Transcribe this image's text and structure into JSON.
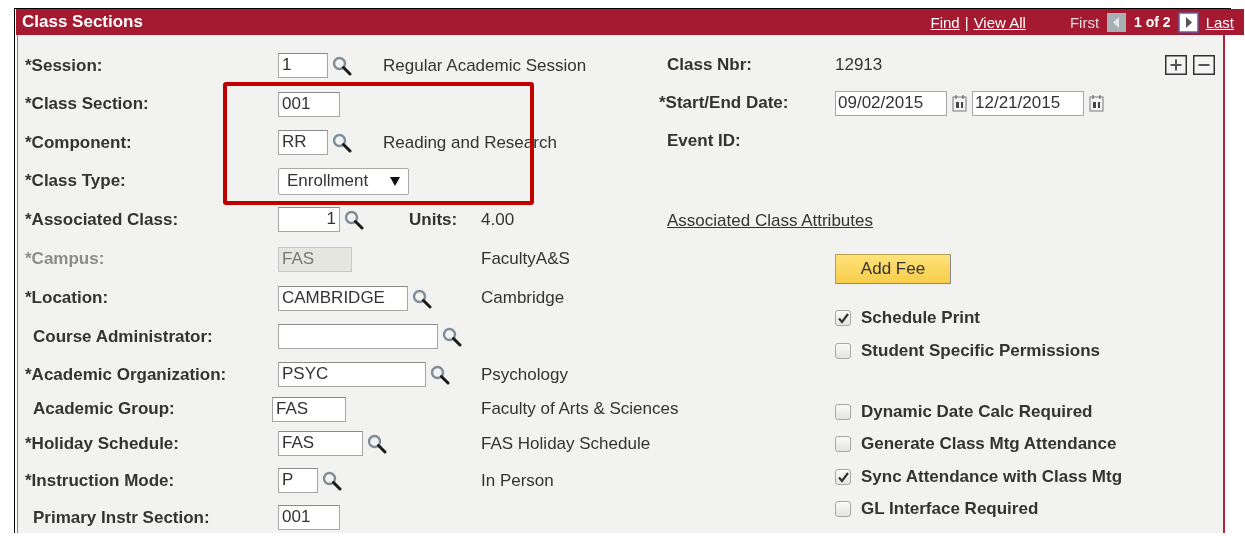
{
  "header": {
    "title": "Class Sections",
    "links": [
      {
        "label": "Find"
      },
      {
        "label": "View All"
      }
    ],
    "separator": "|",
    "first": {
      "label": "First",
      "disabled": true
    },
    "prev": {
      "disabled": true
    },
    "position": "1 of 2",
    "next": {
      "disabled": false
    },
    "last": {
      "label": "Last",
      "disabled": false
    }
  },
  "fields": [
    {
      "label": "*Session:",
      "disabled": false,
      "field": {
        "kind": "lookup",
        "value": "1"
      },
      "description": "Regular Academic Session"
    },
    {
      "label": "*Class Section:",
      "disabled": false,
      "field": {
        "kind": "text",
        "value": "001"
      }
    },
    {
      "label": "*Component:",
      "disabled": false,
      "field": {
        "kind": "lookup",
        "value": "RR"
      },
      "description": "Reading and Research"
    },
    {
      "label": "*Class Type:",
      "disabled": false,
      "field": {
        "kind": "select",
        "value": "Enrollment"
      }
    },
    {
      "label": "*Associated Class:",
      "disabled": false,
      "field": {
        "kind": "lookup",
        "value": "1"
      },
      "units_label": "Units:",
      "units": "4.00"
    },
    {
      "label": "*Campus:",
      "disabled": true,
      "field": {
        "kind": "text",
        "value": "FAS"
      },
      "description": "FacultyA&S"
    },
    {
      "label": "*Location:",
      "disabled": false,
      "field": {
        "kind": "lookup",
        "value": "CAMBRIDGE"
      },
      "description": "Cambridge"
    },
    {
      "label": "Course Administrator:",
      "disabled": false,
      "field": {
        "kind": "lookup"
      }
    },
    {
      "label": "*Academic Organization:",
      "disabled": false,
      "field": {
        "kind": "lookup",
        "value": "PSYC"
      },
      "description": "Psychology"
    },
    {
      "label": "Academic Group:",
      "disabled": false,
      "field": {
        "kind": "text",
        "value": "FAS"
      },
      "description": "Faculty of Arts & Sciences"
    },
    {
      "label": "*Holiday Schedule:",
      "disabled": false,
      "field": {
        "kind": "lookup",
        "value": "FAS"
      },
      "description": "FAS Holiday Schedule"
    },
    {
      "label": "*Instruction Mode:",
      "disabled": false,
      "field": {
        "kind": "lookup",
        "value": "P"
      },
      "description": "In Person"
    },
    {
      "label": "Primary Instr Section:",
      "disabled": false,
      "field": {
        "kind": "text",
        "value": "001"
      }
    }
  ],
  "side": [
    {
      "kind": "value",
      "label": "Class Nbr:",
      "value": "12913"
    },
    {
      "kind": "dates",
      "label": "*Start/End Date:",
      "start": "09/02/2015",
      "end": "12/21/2015"
    },
    {
      "kind": "label",
      "label": "Event ID:"
    },
    {
      "kind": "link",
      "label": "Associated Class Attributes"
    },
    {
      "kind": "button",
      "label": "Add Fee"
    },
    {
      "kind": "checkbox",
      "label": "Schedule Print",
      "checked": true
    },
    {
      "kind": "checkbox",
      "label": "Student Specific Permissions",
      "checked": false
    },
    {
      "kind": "checkbox",
      "label": "Dynamic Date Calc Required",
      "checked": false
    },
    {
      "kind": "checkbox",
      "label": "Generate Class Mtg Attendance",
      "checked": false
    },
    {
      "kind": "checkbox",
      "label": "Sync Attendance with Class Mtg",
      "checked": true
    },
    {
      "kind": "checkbox",
      "label": "GL Interface Required",
      "checked": false
    }
  ]
}
